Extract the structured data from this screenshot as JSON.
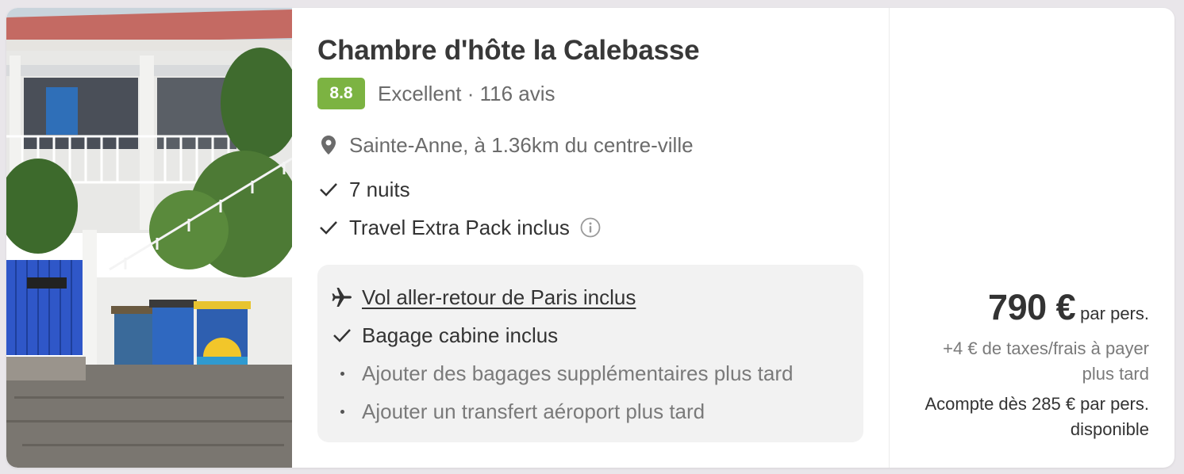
{
  "listing": {
    "photo_alt": "hotel-photo",
    "title": "Chambre d'hôte la Calebasse",
    "score": "8.8",
    "rating_text": "Excellent · 116 avis",
    "location": "Sainte-Anne, à 1.36km du centre-ville",
    "features": [
      "7 nuits",
      "Travel Extra Pack inclus"
    ]
  },
  "flight": {
    "link_label": "Vol aller-retour de Paris inclus",
    "items": [
      "Bagage cabine inclus",
      "Ajouter des bagages supplémentaires plus tard",
      "Ajouter un transfert aéroport plus tard"
    ]
  },
  "pricing": {
    "price": "790 €",
    "per_label": "par pers.",
    "taxes": "+4 € de taxes/frais à payer plus tard",
    "deposit": "Acompte dès 285 € par pers. disponible"
  },
  "colors": {
    "score_badge": "#7cb342",
    "background": "#e9e6ea",
    "flight_box": "#f2f2f2"
  },
  "icons": {
    "location": "map-pin-icon",
    "check": "check-icon",
    "info": "info-circle-icon",
    "flight": "airplane-icon",
    "bullet": "bullet-dot-icon"
  }
}
